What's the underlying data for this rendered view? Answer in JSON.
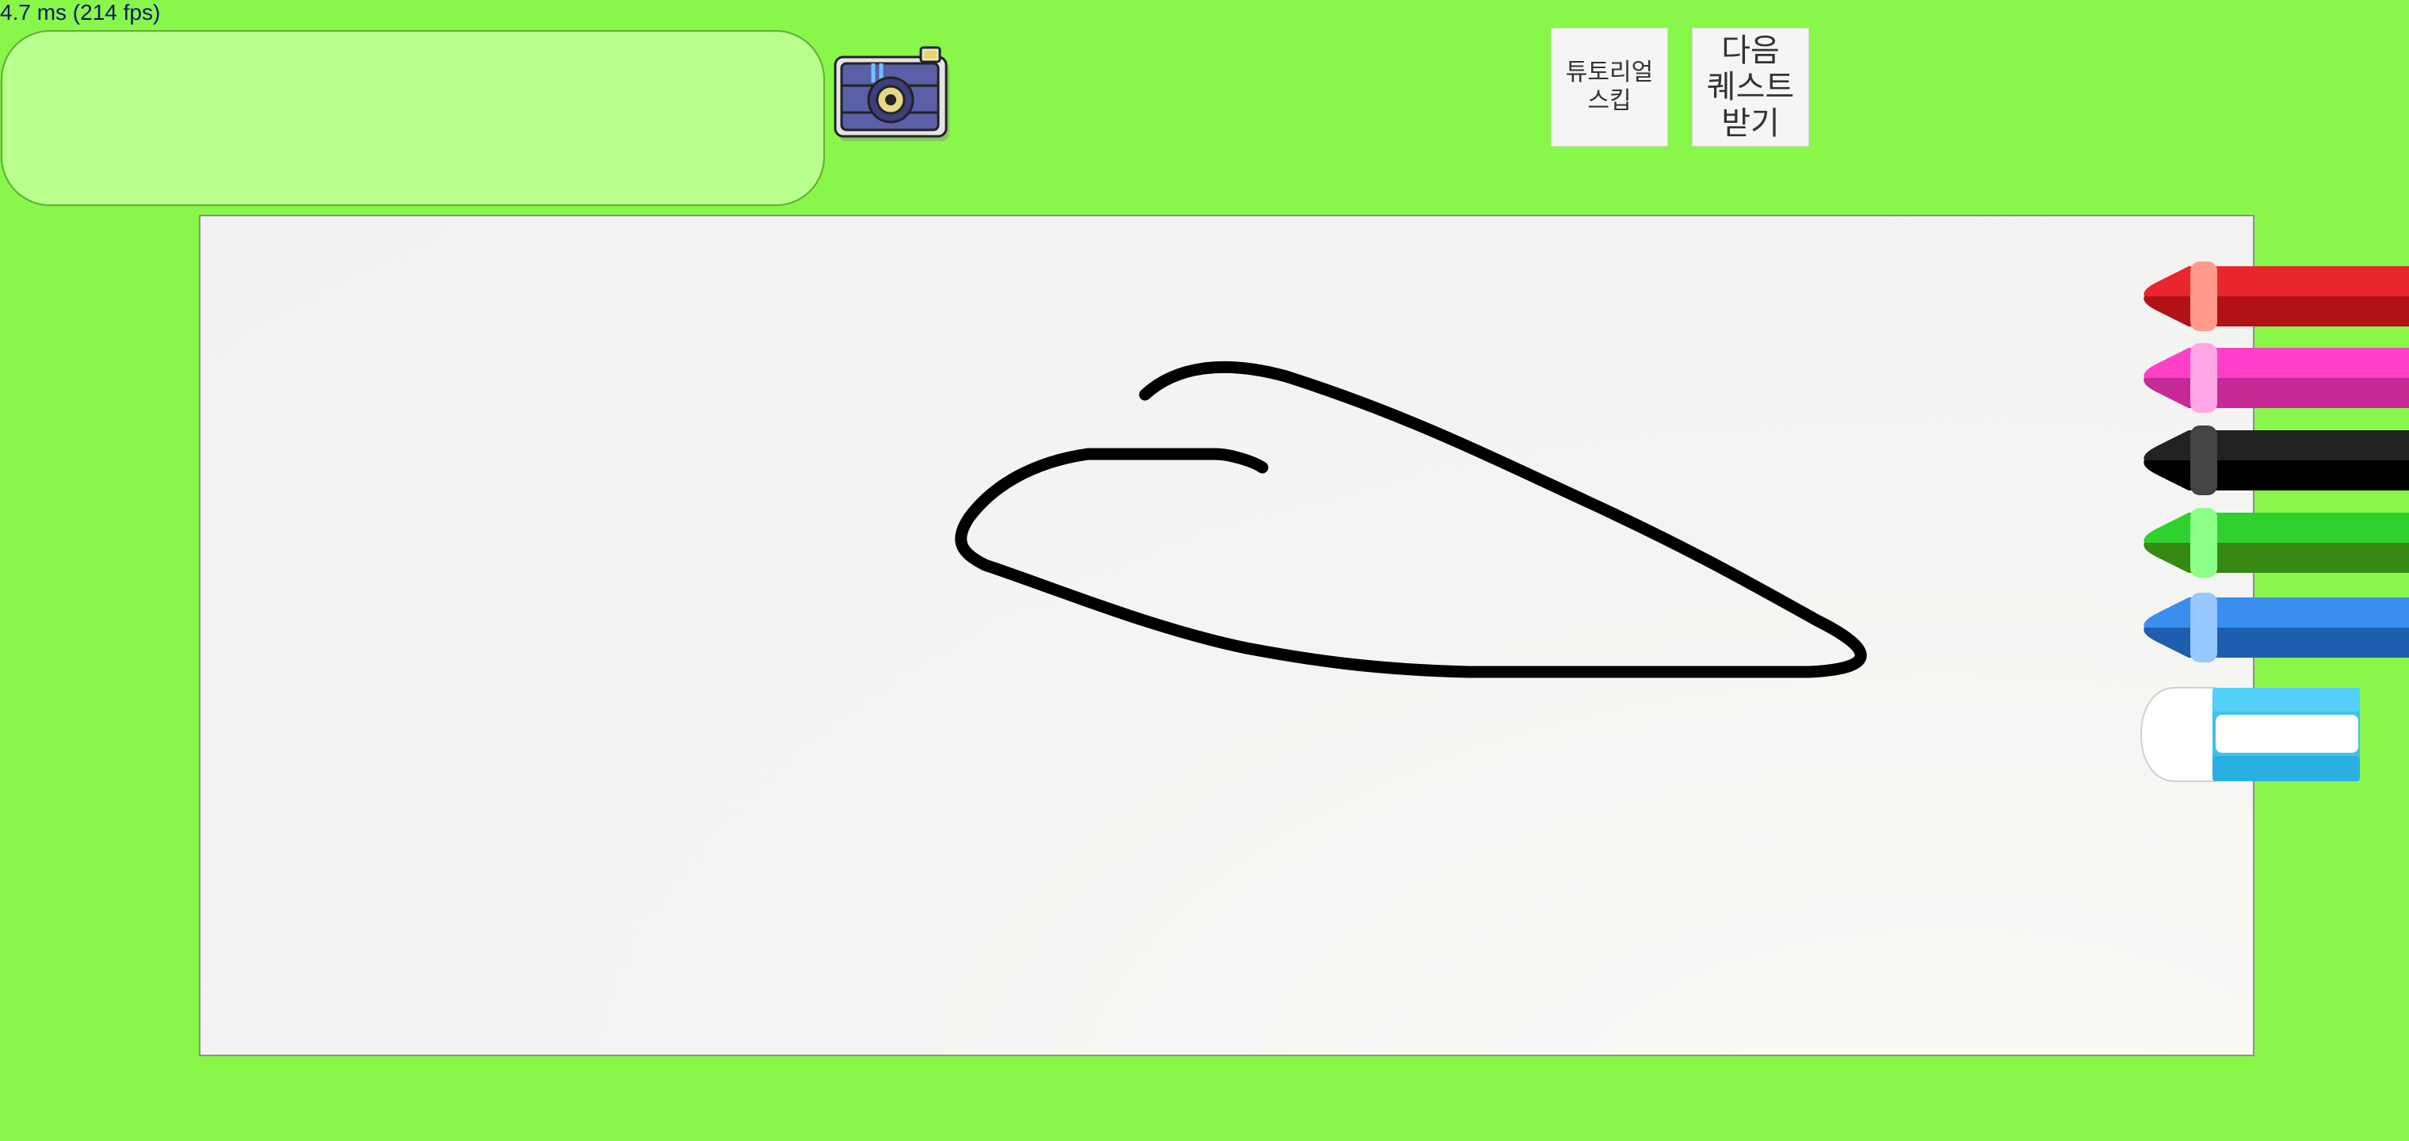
{
  "fps_readout": "4.7 ms (214 fps)",
  "quest_text": "",
  "buttons": {
    "skip_tutorial": "튜토리얼\n스킵",
    "next_quest": "다음\n퀘스트\n받기"
  },
  "icons": {
    "camera": "camera-icon",
    "eraser": "eraser-icon"
  },
  "colors": {
    "background": "#89f64a",
    "quest_box": "#b8ff8e",
    "canvas": "#f3f3f1",
    "stroke": "#000000"
  },
  "crayons": [
    {
      "name": "red",
      "body": "#e8262b",
      "shade": "#b11216",
      "band": "#ff9a8c"
    },
    {
      "name": "pink",
      "body": "#ff3fc7",
      "shade": "#c52a97",
      "band": "#ffa6e6"
    },
    {
      "name": "black",
      "body": "#222222",
      "shade": "#000000",
      "band": "#444444"
    },
    {
      "name": "green",
      "body": "#2ed12e",
      "shade": "#368a14",
      "band": "#8cff86"
    },
    {
      "name": "blue",
      "body": "#3a8ef0",
      "shade": "#1d5fae",
      "band": "#96c8ff"
    }
  ]
}
